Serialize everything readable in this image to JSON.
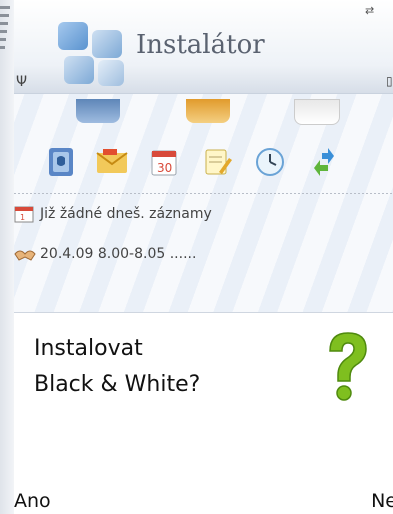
{
  "status": {
    "top_icon": "⇄"
  },
  "header": {
    "title": "Instalátor"
  },
  "agenda": {
    "no_entries": "Již žádné dneš. záznamy",
    "entry": "20.4.09 8.00-8.05 ......"
  },
  "dialog": {
    "message": "Instalovat\nBlack & White?",
    "icon": "question-mark-icon"
  },
  "softkeys": {
    "left": "Ano",
    "right": "Ne"
  },
  "colors": {
    "question_green": "#7fbf1f",
    "accent_blue": "#3a8fd8"
  }
}
